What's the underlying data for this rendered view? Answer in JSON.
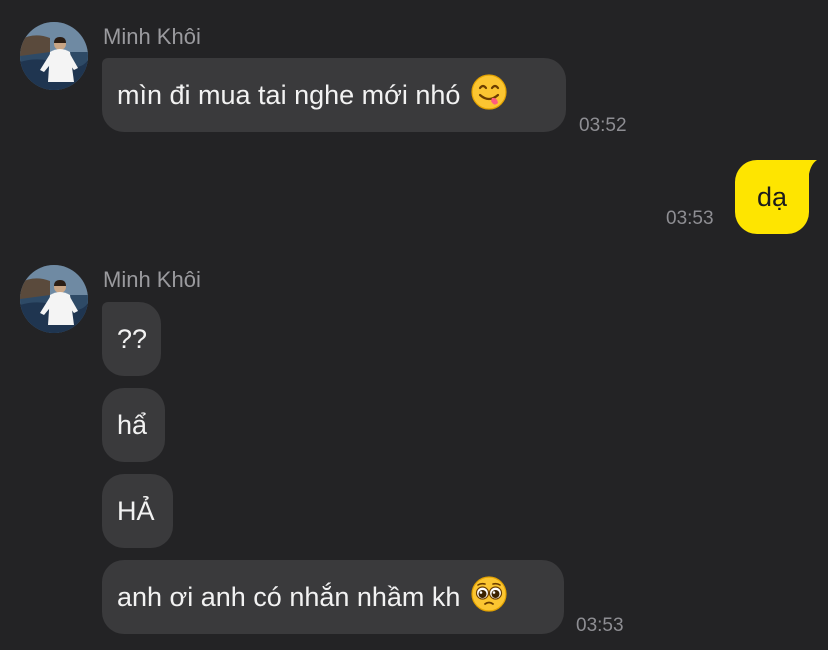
{
  "messages": {
    "group1": {
      "sender": "Minh Khôi",
      "text": "mìn đi mua tai nghe mới nhó",
      "emoji": "yum-face",
      "time": "03:52"
    },
    "mine": {
      "text": "dạ",
      "time": "03:53"
    },
    "group2": {
      "sender": "Minh Khôi",
      "bubbles": [
        "??",
        "hẩ",
        "HẢ",
        "anh ơi anh có nhắn nhầm kh"
      ],
      "last_emoji": "pleading-face",
      "time": "03:53"
    }
  },
  "colors": {
    "background": "#232325",
    "incoming_bubble": "#3a3a3c",
    "outgoing_bubble": "#fee500",
    "sender_name": "#9a9a9e",
    "timestamp": "#8e8e93"
  }
}
